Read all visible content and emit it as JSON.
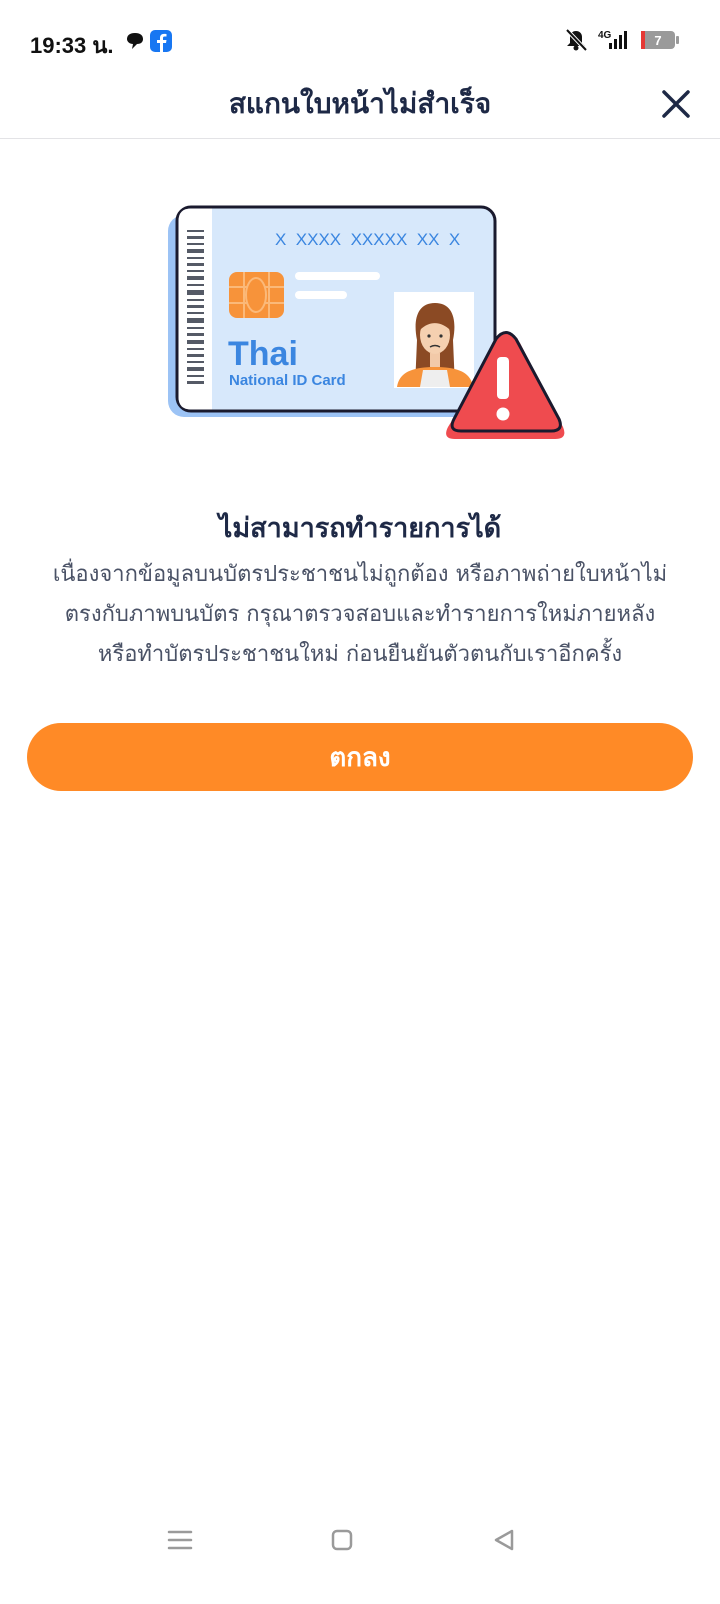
{
  "status_bar": {
    "time": "19:33 น.",
    "network": "4G",
    "battery": "7",
    "icons_left": [
      "chat-bubble-icon",
      "facebook-icon"
    ],
    "icons_right": [
      "bell-muted-icon",
      "signal-4g-icon",
      "battery-icon"
    ]
  },
  "header": {
    "title": "สแกนใบหน้าไม่สำเร็จ",
    "close_icon": "close-icon"
  },
  "illustration": {
    "card_number": "X  XXXX  XXXXX  XX  X",
    "card_title": "Thai",
    "card_subtitle": "National ID Card",
    "warning_icon": "warning-triangle-icon"
  },
  "message": {
    "title": "ไม่สามารถทำรายการได้",
    "lines": [
      "เนื่องจากข้อมูลบนบัตรประชาชนไม่ถูกต้อง หรือภาพถ่ายใบหน้าไม่",
      "ตรงกับภาพบนบัตร กรุณาตรวจสอบและทำรายการใหม่ภายหลัง",
      "หรือทำบัตรประชาชนใหม่ ก่อนยืนยันตัวตนกับเราอีกครั้ง"
    ]
  },
  "actions": {
    "ok_label": "ตกลง"
  },
  "colors": {
    "accent": "#ff8a26",
    "title_text": "#1e2946",
    "body_text": "#4a5266",
    "card_blue": "#d7e8fb",
    "card_text_blue": "#3b86e0",
    "warning_red": "#ef4b4f"
  },
  "nav": {
    "icons": [
      "menu-icon",
      "home-icon",
      "back-icon"
    ]
  }
}
